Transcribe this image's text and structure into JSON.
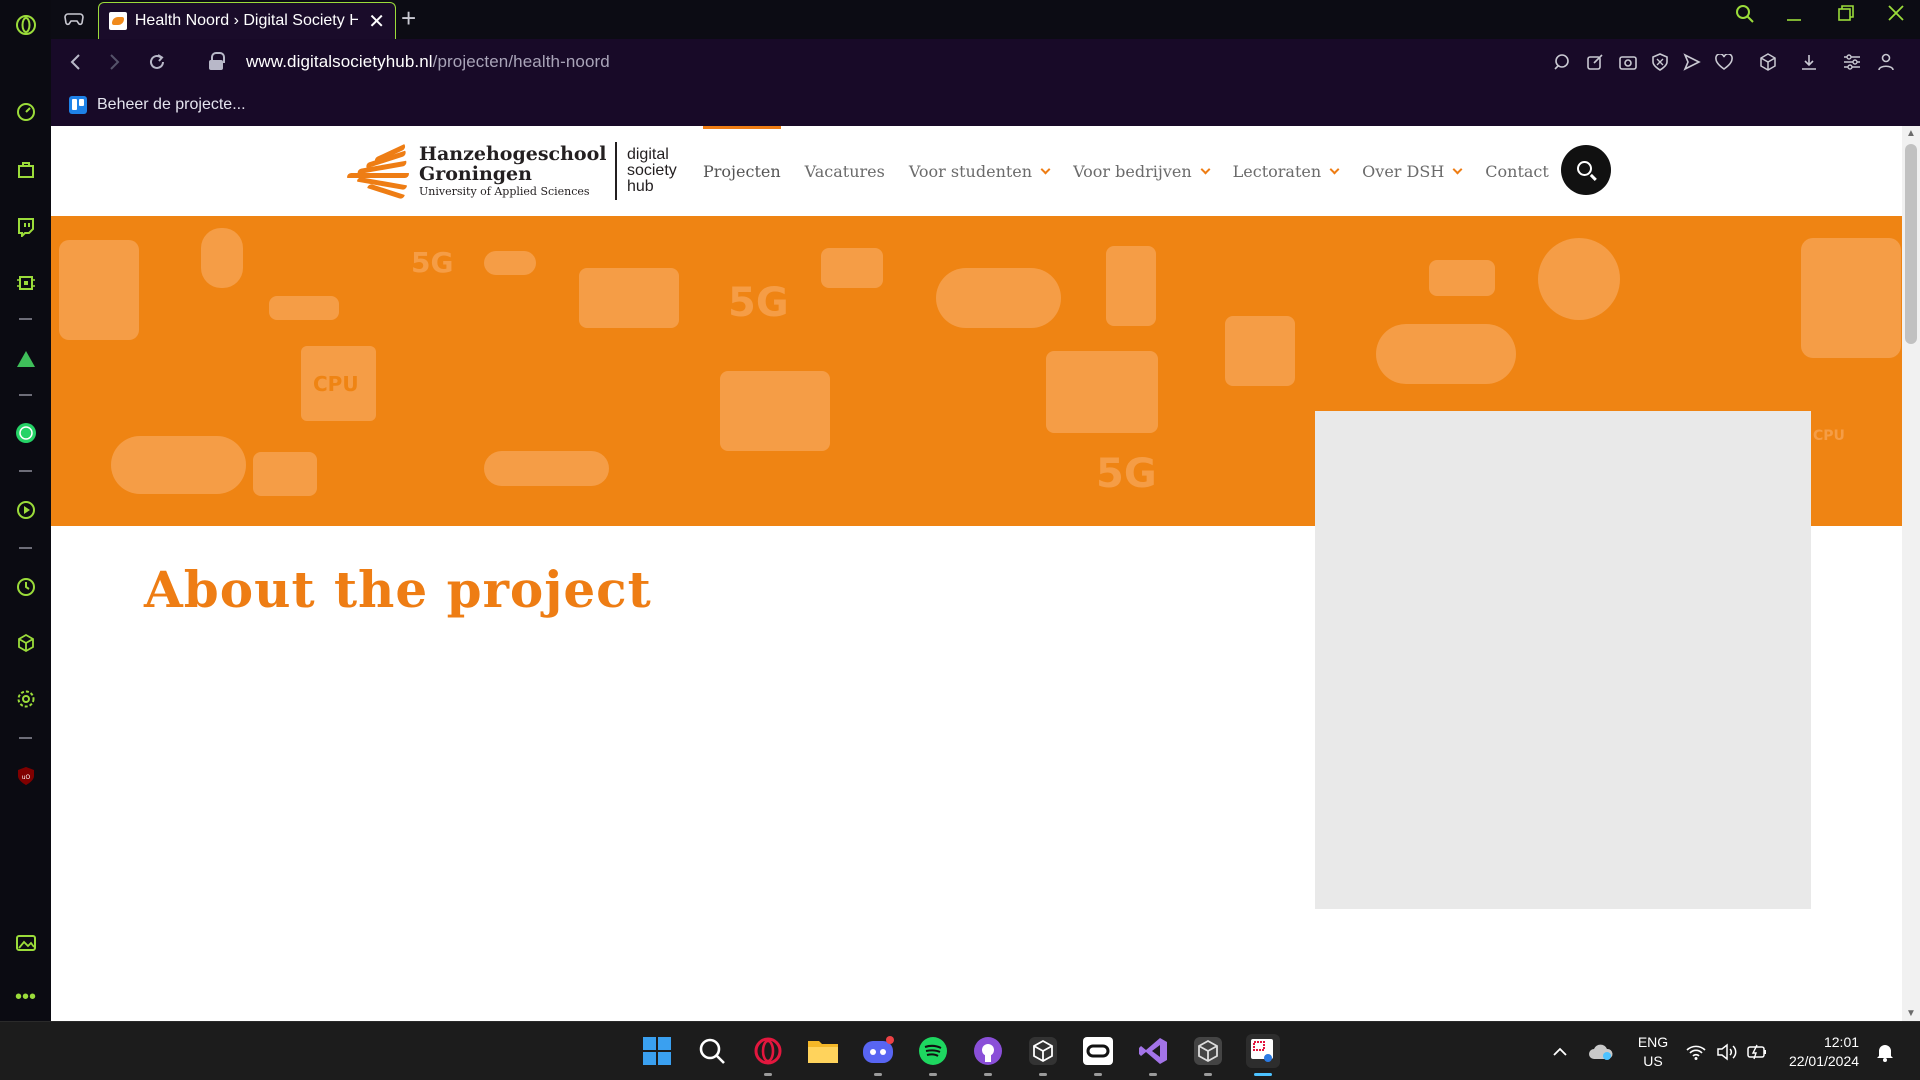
{
  "browser": {
    "tab_title": "Health Noord › Digital Society Hub",
    "url_host": "www.digitalsocietyhub.nl",
    "url_path": "/projecten/health-noord",
    "bookmark_label": "Beheer de projecte..."
  },
  "site": {
    "logo": {
      "school_line1": "Hanzehogeschool",
      "school_line2": "Groningen",
      "school_line3": "University of Applied Sciences",
      "dsh_line1": "digital",
      "dsh_line2": "society",
      "dsh_line3": "hub"
    },
    "menu": [
      {
        "label": "Projecten",
        "active": true,
        "has_dropdown": false
      },
      {
        "label": "Vacatures",
        "active": false,
        "has_dropdown": false
      },
      {
        "label": "Voor studenten",
        "active": false,
        "has_dropdown": true
      },
      {
        "label": "Voor bedrijven",
        "active": false,
        "has_dropdown": true
      },
      {
        "label": "Lectoraten",
        "active": false,
        "has_dropdown": true
      },
      {
        "label": "Over DSH",
        "active": false,
        "has_dropdown": true
      },
      {
        "label": "Contact",
        "active": false,
        "has_dropdown": false
      }
    ],
    "hero_pattern_labels": [
      "5G",
      "CPU",
      "5G",
      "5G",
      "CPU"
    ],
    "section_title": "About the project"
  },
  "taskbar": {
    "language_line1": "ENG",
    "language_line2": "US",
    "time": "12:01",
    "date": "22/01/2024"
  },
  "colors": {
    "accent": "#ee7d14",
    "hero_bg": "#ef8413",
    "browser_accent": "#9bdc3a",
    "placeholder": "#e9e9e9"
  }
}
